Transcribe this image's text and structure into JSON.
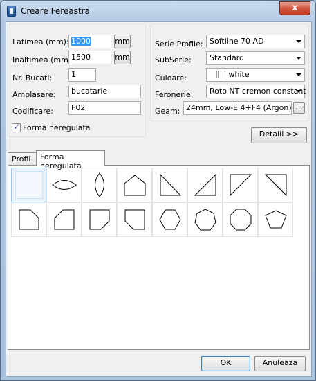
{
  "window": {
    "title": "Creare Fereastra",
    "close_glyph": "x"
  },
  "left_form": {
    "latimea_label": "Latimea (mm):",
    "latimea_value": "1000",
    "latimea_unit": "mm",
    "inaltimea_label": "Inaltimea (mm):",
    "inaltimea_value": "1500",
    "inaltimea_unit": "mm",
    "bucati_label": "Nr. Bucati:",
    "bucati_value": "1",
    "amplasare_label": "Amplasare:",
    "amplasare_value": "bucatarie",
    "codificare_label": "Codificare:",
    "codificare_value": "F02",
    "forma_checkbox_label": "Forma neregulata",
    "forma_checked": true
  },
  "right_form": {
    "serie_label": "Serie Profile:",
    "serie_value": "Softline 70 AD",
    "subserie_label": "SubSerie:",
    "subserie_value": "Standard",
    "culoare_label": "Culoare:",
    "culoare_value": "white",
    "feronerie_label": "Feronerie:",
    "feronerie_value": "Roto NT cremon constant",
    "geam_label": "Geam:",
    "geam_value": "24mm, Low-E 4+F4 (Argon)",
    "geam_button": "..."
  },
  "details_button": "Detalii >>",
  "tabs": [
    {
      "label": "Profil",
      "active": false
    },
    {
      "label": "Forma neregulata",
      "active": true
    }
  ],
  "shapes_row1": [
    "blank-selected",
    "ellipse-horizontal",
    "ellipse-vertical",
    "pentagon-house",
    "triangle-right-bottom-left",
    "triangle-right-bottom-right",
    "triangle-top-left",
    "triangle-top-right"
  ],
  "shapes_row2": [
    "cut-corner-top-right",
    "cut-corner-top-left",
    "cut-corner-bottom-right",
    "cut-corner-bottom-left",
    "hexagon",
    "heptagon",
    "octagon",
    "pentagon-inverted"
  ],
  "footer": {
    "ok_label": "OK",
    "cancel_label": "Anuleaza"
  }
}
